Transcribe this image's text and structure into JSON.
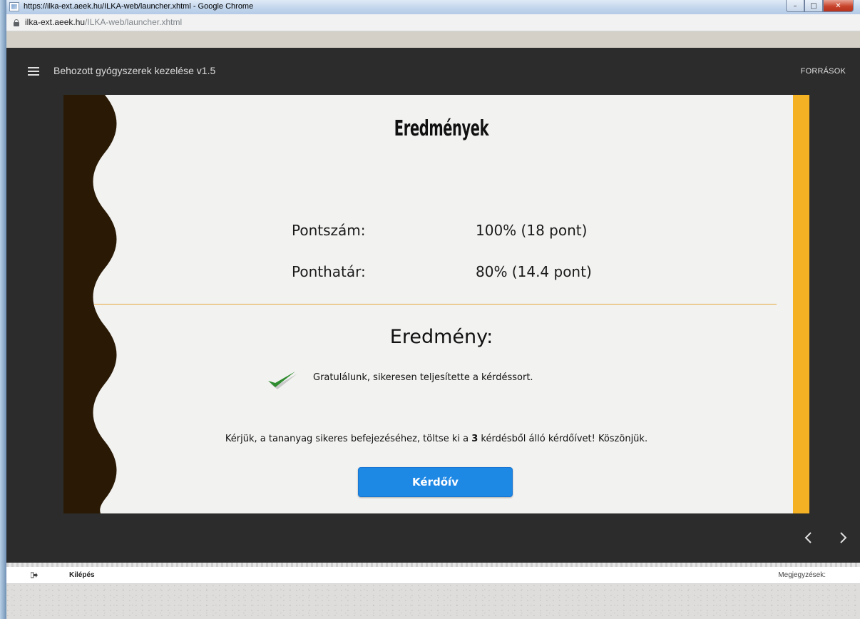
{
  "browser": {
    "window_title": "https://ilka-ext.aeek.hu/ILKA-web/launcher.xhtml - Google Chrome",
    "url_host": "ilka-ext.aeek.hu",
    "url_path": "/ILKA-web/launcher.xhtml"
  },
  "header": {
    "course_title": "Behozott gyógyszerek kezelése v1.5",
    "sources_label": "FORRÁSOK"
  },
  "results": {
    "title": "Eredmények",
    "score_label": "Pontszám:",
    "score_value": "100% (18 pont)",
    "threshold_label": "Ponthatár:",
    "threshold_value": "80% (14.4 pont)",
    "result_heading": "Eredmény:",
    "congrats_text": "Gratulálunk, sikeresen teljesítette a kérdéssort.",
    "survey_note_before": "Kérjük, a tananyag sikeres befejezéséhez, töltse ki a ",
    "survey_note_count": "3",
    "survey_note_after": " kérdésből álló kérdőívet! Köszönjük.",
    "survey_button_label": "Kérdőív"
  },
  "footer": {
    "exit_label": "Kilépés",
    "notes_label": "Megjegyzések:"
  },
  "colors": {
    "app_background": "#2c2c2c",
    "slide_background": "#f2f2f1",
    "accent_stripe": "#f4b124",
    "wave": "#2a1a05",
    "button": "#1e88e5",
    "check": "#2e8b2e"
  },
  "icons": [
    "menu-icon",
    "lock-icon",
    "check-icon",
    "chevron-left-icon",
    "chevron-right-icon",
    "exit-icon"
  ]
}
